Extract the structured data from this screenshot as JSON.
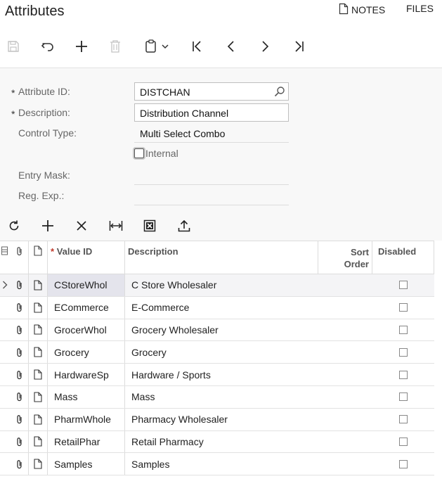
{
  "page": {
    "title": "Attributes"
  },
  "top_links": {
    "notes": "NOTES",
    "files": "FILES"
  },
  "toolbar": {
    "buttons": [
      {
        "name": "save-icon",
        "enabled": false
      },
      {
        "name": "undo-icon",
        "enabled": true
      },
      {
        "name": "add-icon",
        "enabled": true
      },
      {
        "name": "delete-icon",
        "enabled": false
      },
      {
        "name": "clipboard-icon",
        "enabled": true
      },
      {
        "name": "first-record-icon",
        "enabled": true
      },
      {
        "name": "previous-record-icon",
        "enabled": true
      },
      {
        "name": "next-record-icon",
        "enabled": true
      },
      {
        "name": "last-record-icon",
        "enabled": true
      }
    ]
  },
  "form": {
    "attribute_id": {
      "label": "Attribute ID:",
      "value": "DISTCHAN",
      "required_mark": "*"
    },
    "description": {
      "label": "Description:",
      "value": "Distribution Channel",
      "required_mark": "*"
    },
    "control_type": {
      "label": "Control Type:",
      "value": "Multi Select Combo"
    },
    "internal": {
      "label": "Internal",
      "checked": false
    },
    "entry_mask": {
      "label": "Entry Mask:",
      "value": ""
    },
    "reg_exp": {
      "label": "Reg. Exp.:",
      "value": ""
    }
  },
  "grid_toolbar": {
    "buttons": [
      "refresh-icon",
      "add-row-icon",
      "delete-row-icon",
      "fit-columns-icon",
      "export-excel-icon",
      "upload-icon"
    ]
  },
  "grid": {
    "columns": {
      "value_id": "Value ID",
      "value_id_required": "*",
      "description": "Description",
      "sort_order": "Sort Order",
      "disabled": "Disabled"
    },
    "rows": [
      {
        "value_id": "CStoreWhol",
        "description": "C Store Wholesaler",
        "sort_order": "",
        "disabled": false,
        "selected": true
      },
      {
        "value_id": "ECommerce",
        "description": "E-Commerce",
        "sort_order": "",
        "disabled": false
      },
      {
        "value_id": "GrocerWhol",
        "description": "Grocery Wholesaler",
        "sort_order": "",
        "disabled": false
      },
      {
        "value_id": "Grocery",
        "description": "Grocery",
        "sort_order": "",
        "disabled": false
      },
      {
        "value_id": "HardwareSp",
        "description": "Hardware / Sports",
        "sort_order": "",
        "disabled": false
      },
      {
        "value_id": "Mass",
        "description": "Mass",
        "sort_order": "",
        "disabled": false
      },
      {
        "value_id": "PharmWhole",
        "description": "Pharmacy Wholesaler",
        "sort_order": "",
        "disabled": false
      },
      {
        "value_id": "RetailPhar",
        "description": "Retail Pharmacy",
        "sort_order": "",
        "disabled": false
      },
      {
        "value_id": "Samples",
        "description": "Samples",
        "sort_order": "",
        "disabled": false
      }
    ]
  }
}
